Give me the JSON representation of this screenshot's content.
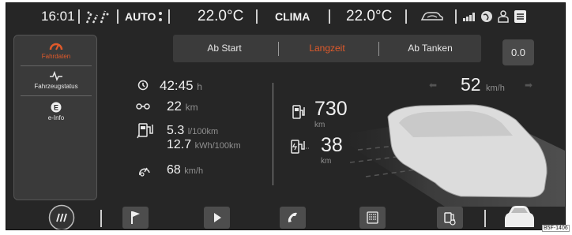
{
  "status_bar": {
    "time": "16:01",
    "mode": "AUTO",
    "temp_left": "22.0°C",
    "clima": "CLIMA",
    "temp_right": "22.0°C"
  },
  "sidebar": {
    "items": [
      {
        "label": "Fahrdaten",
        "icon": "speedometer-icon",
        "active": true
      },
      {
        "label": "Fahrzeugstatus",
        "icon": "pulse-icon",
        "active": false
      },
      {
        "label": "e-Info",
        "icon": "e-icon",
        "active": false
      }
    ]
  },
  "tabs": [
    {
      "label": "Ab Start",
      "active": false
    },
    {
      "label": "Langzeit",
      "active": true
    },
    {
      "label": "Ab Tanken",
      "active": false
    }
  ],
  "reset_label": "0.0",
  "trip": {
    "time": "42:45",
    "time_unit": "h",
    "distance": "22",
    "distance_unit": "km",
    "fuel_consumption": "5.3",
    "fuel_unit": "l/100km",
    "electric_consumption": "12.7",
    "electric_unit": "kWh/100km",
    "avg_speed": "68",
    "speed_unit": "km/h"
  },
  "range": {
    "fuel_range": "730",
    "fuel_range_unit": "km",
    "electric_range": "38",
    "electric_range_unit": "km"
  },
  "current_speed": {
    "value": "52",
    "unit": "km/h"
  },
  "bottom_bar": [
    "menu-icon",
    "flag-icon",
    "play-icon",
    "phone-icon",
    "keyboard-icon",
    "fuel-icon",
    "car-icon"
  ],
  "figure_tag": "B5F-1406",
  "colors": {
    "accent": "#e05a2b",
    "background": "#262626"
  }
}
